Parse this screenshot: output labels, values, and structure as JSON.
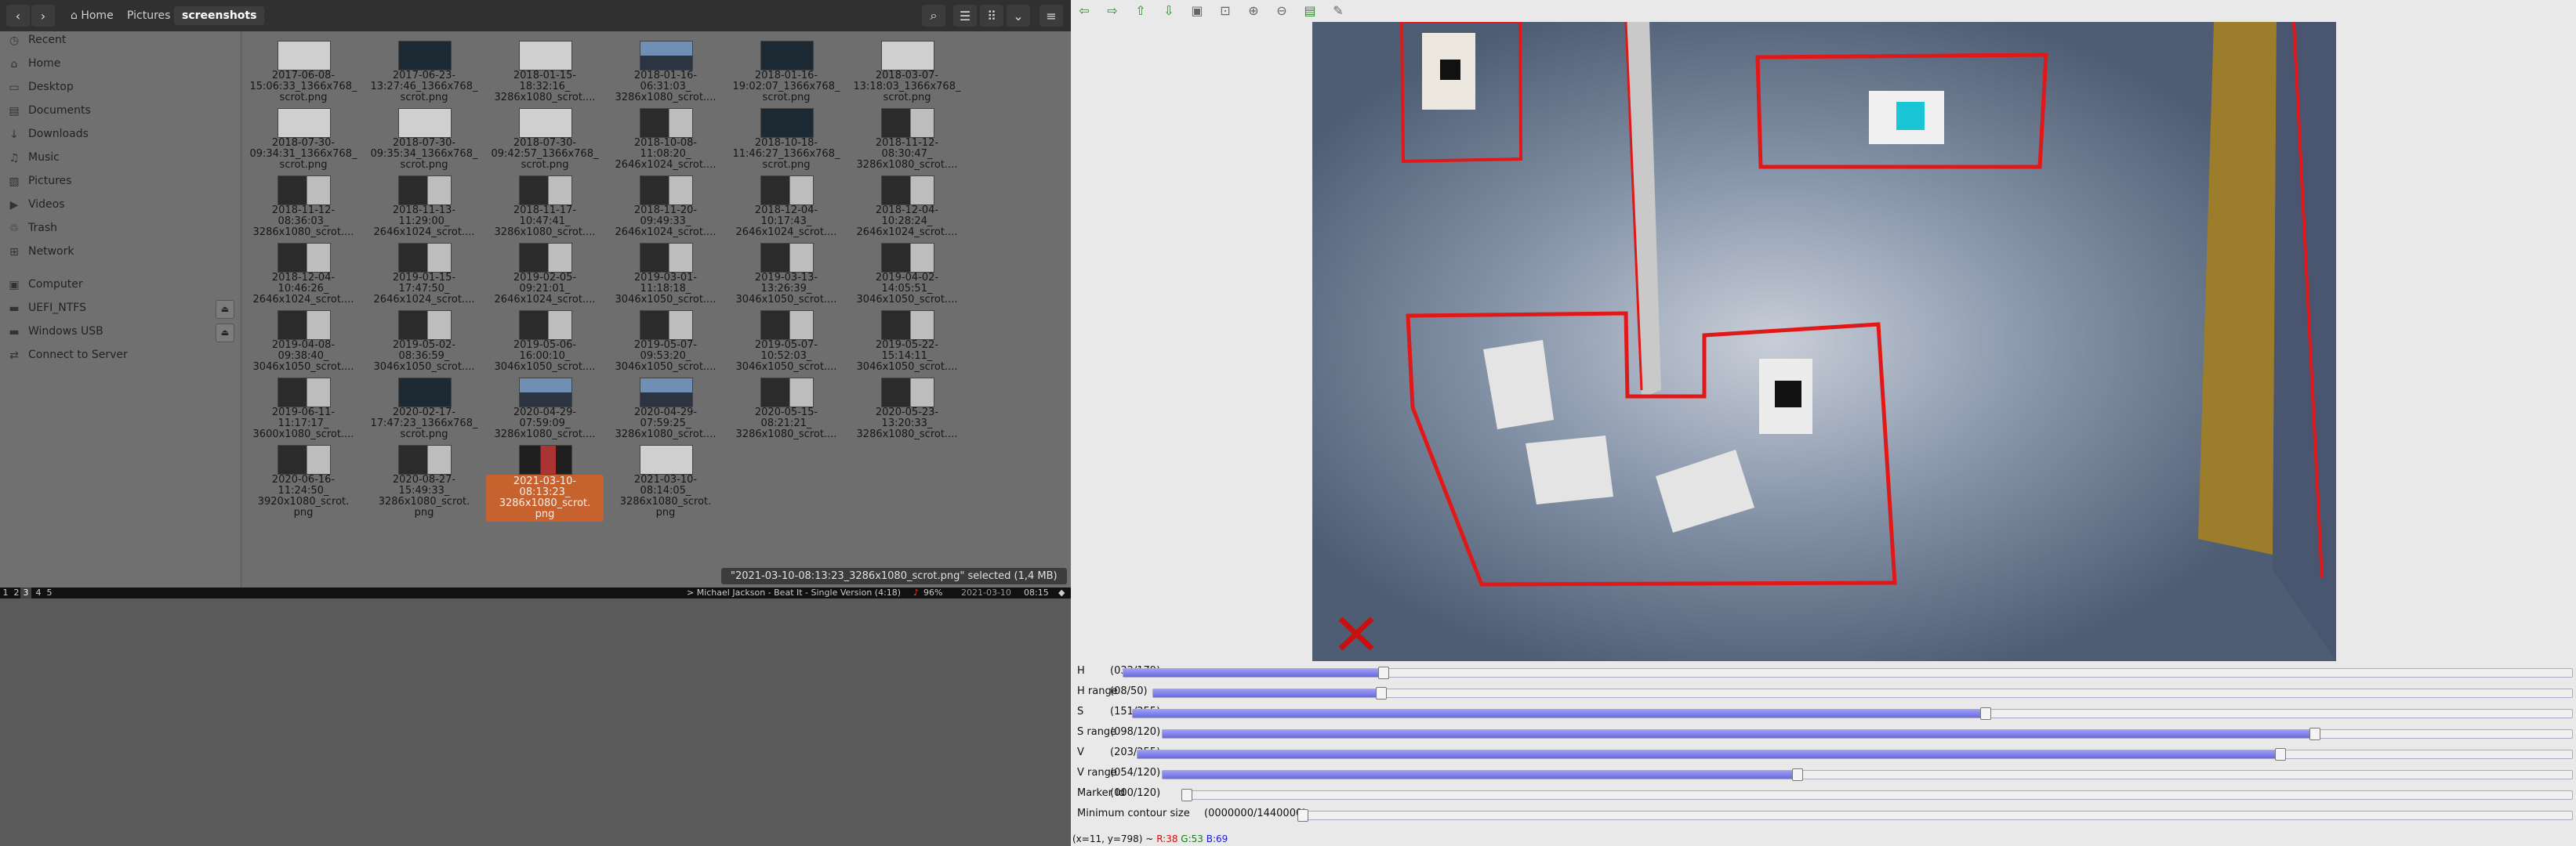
{
  "file_manager": {
    "nav": {
      "back": "‹",
      "forward": "›"
    },
    "breadcrumb": [
      "Home",
      "Pictures",
      "screenshots"
    ],
    "sidebar": [
      {
        "label": "Recent",
        "icon": "clock-icon"
      },
      {
        "label": "Home",
        "icon": "home-icon"
      },
      {
        "label": "Desktop",
        "icon": "desktop-icon"
      },
      {
        "label": "Documents",
        "icon": "document-icon"
      },
      {
        "label": "Downloads",
        "icon": "download-icon"
      },
      {
        "label": "Music",
        "icon": "music-icon"
      },
      {
        "label": "Pictures",
        "icon": "picture-icon"
      },
      {
        "label": "Videos",
        "icon": "video-icon"
      },
      {
        "label": "Trash",
        "icon": "trash-icon"
      },
      {
        "label": "Network",
        "icon": "network-icon"
      },
      {
        "label": "Computer",
        "icon": "computer-icon"
      },
      {
        "label": "UEFI_NTFS",
        "icon": "drive-icon"
      },
      {
        "label": "Windows USB",
        "icon": "drive-icon"
      },
      {
        "label": "Connect to Server",
        "icon": "server-icon"
      }
    ],
    "files": [
      "2017-06-08-\n15:06:33_1366x768_\nscrot.png",
      "2017-06-23-\n13:27:46_1366x768_\nscrot.png",
      "2018-01-15-\n18:32:16_\n3286x1080_scrot....",
      "2018-01-16-\n06:31:03_\n3286x1080_scrot....",
      "2018-01-16-\n19:02:07_1366x768_\nscrot.png",
      "2018-03-07-\n13:18:03_1366x768_\nscrot.png",
      "2018-07-30-\n09:34:31_1366x768_\nscrot.png",
      "2018-07-30-\n09:35:34_1366x768_\nscrot.png",
      "2018-07-30-\n09:42:57_1366x768_\nscrot.png",
      "2018-10-08-\n11:08:20_\n2646x1024_scrot....",
      "2018-10-18-\n11:46:27_1366x768_\nscrot.png",
      "2018-11-12-\n08:30:47_\n3286x1080_scrot....",
      "2018-11-12-\n08:36:03_\n3286x1080_scrot....",
      "2018-11-13-\n11:29:00_\n2646x1024_scrot....",
      "2018-11-17-\n10:47:41_\n3286x1080_scrot....",
      "2018-11-20-\n09:49:33_\n2646x1024_scrot....",
      "2018-12-04-\n10:17:43_\n2646x1024_scrot....",
      "2018-12-04-\n10:28:24_\n2646x1024_scrot....",
      "2018-12-04-\n10:46:26_\n2646x1024_scrot....",
      "2019-01-15-\n17:47:50_\n2646x1024_scrot....",
      "2019-02-05-\n09:21:01_\n2646x1024_scrot....",
      "2019-03-01-\n11:18:18_\n3046x1050_scrot....",
      "2019-03-13-\n13:26:39_\n3046x1050_scrot....",
      "2019-04-02-\n14:05:51_\n3046x1050_scrot....",
      "2019-04-08-\n09:38:40_\n3046x1050_scrot....",
      "2019-05-02-\n08:36:59_\n3046x1050_scrot....",
      "2019-05-06-\n16:00:10_\n3046x1050_scrot....",
      "2019-05-07-\n09:53:20_\n3046x1050_scrot....",
      "2019-05-07-\n10:52:03_\n3046x1050_scrot....",
      "2019-05-22-\n15:14:11_\n3046x1050_scrot....",
      "2019-06-11-\n11:17:17_\n3600x1080_scrot....",
      "2020-02-17-\n17:47:23_1366x768_\nscrot.png",
      "2020-04-29-\n07:59:09_\n3286x1080_scrot....",
      "2020-04-29-\n07:59:25_\n3286x1080_scrot....",
      "2020-05-15-\n08:21:21_\n3286x1080_scrot....",
      "2020-05-23-\n13:20:33_\n3286x1080_scrot....",
      "2020-06-16-\n11:24:50_\n3920x1080_scrot.\npng",
      "2020-08-27-\n15:49:33_\n3286x1080_scrot.\npng",
      "2021-03-10-\n08:13:23_\n3286x1080_scrot.\npng",
      "2021-03-10-\n08:14:05_\n3286x1080_scrot.\npng"
    ],
    "selected_index": 38,
    "status": "\"2021-03-10-08:13:23_3286x1080_scrot.png\" selected (1,4 MB)"
  },
  "taskbar": {
    "workspaces": [
      "1",
      "2",
      "3",
      "4",
      "5"
    ],
    "now_playing": "> Michael Jackson - Beat It - Single Version (4:18)",
    "volume": "96%",
    "date": "2021-03-10",
    "time": "08:15"
  },
  "tuner": {
    "sliders": [
      {
        "name": "H",
        "value": "(032/179)",
        "frac": 0.179
      },
      {
        "name": "H range",
        "value": "(08/50)",
        "frac": 0.16
      },
      {
        "name": "S",
        "value": "(151/255)",
        "frac": 0.592
      },
      {
        "name": "S range",
        "value": "(098/120)",
        "frac": 0.817
      },
      {
        "name": "V",
        "value": "(203/255)",
        "frac": 0.796
      },
      {
        "name": "V range",
        "value": "(054/120)",
        "frac": 0.45
      },
      {
        "name": "Marker Id",
        "value": "(000/120)",
        "frac": 0.0
      },
      {
        "name": "Minimum contour size",
        "value": "(0000000/1440000)",
        "frac": 0.0
      }
    ],
    "status": {
      "coords": "(x=11, y=798) ~",
      "r": "R:38",
      "g": "G:53",
      "b": "B:69"
    }
  }
}
